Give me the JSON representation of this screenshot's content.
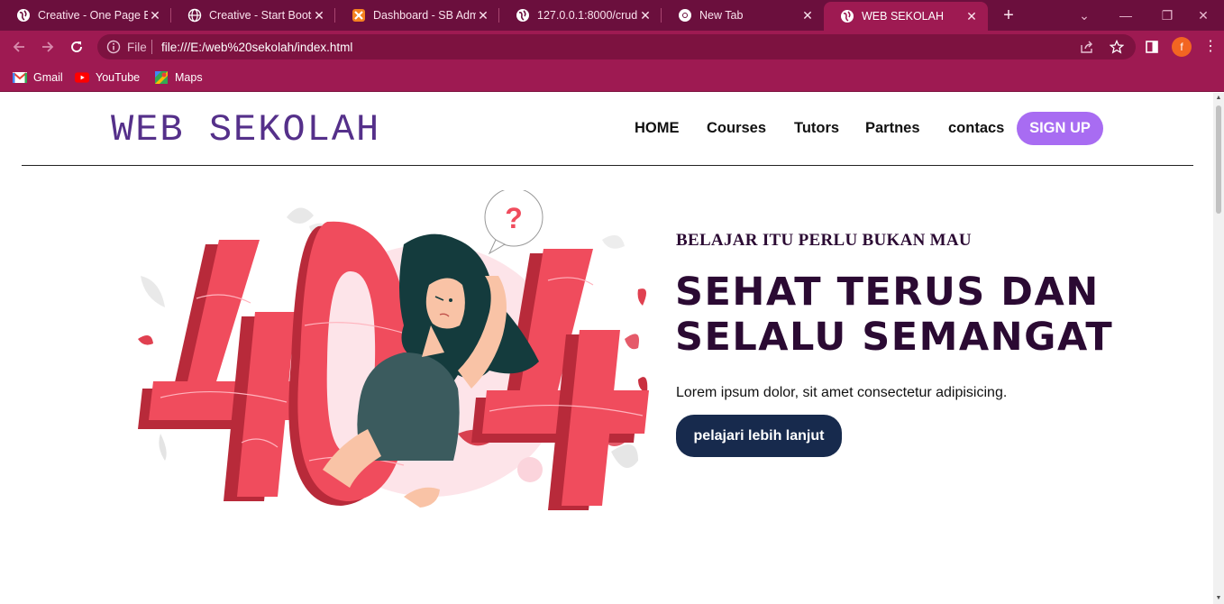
{
  "browser": {
    "tabs": [
      {
        "title": "Creative - One Page Bootstrap",
        "icon": "globe-icon",
        "active": false
      },
      {
        "title": "Creative - Start Bootstrap",
        "icon": "globe-icon",
        "active": false
      },
      {
        "title": "Dashboard - SB Admin",
        "icon": "xampp-icon",
        "active": false
      },
      {
        "title": "127.0.0.1:8000/crud",
        "icon": "globe-icon",
        "active": false
      },
      {
        "title": "New Tab",
        "icon": "chrome-icon",
        "active": false
      },
      {
        "title": "WEB SEKOLAH",
        "icon": "globe-icon",
        "active": true
      }
    ],
    "address": {
      "scheme": "File",
      "url": "file:///E:/web%20sekolah/index.html"
    },
    "profile_initial": "f",
    "bookmarks": [
      {
        "label": "Gmail",
        "icon": "gmail-icon"
      },
      {
        "label": "YouTube",
        "icon": "youtube-icon"
      },
      {
        "label": "Maps",
        "icon": "maps-icon"
      }
    ]
  },
  "page": {
    "logo": "WEB SEKOLAH",
    "nav": {
      "home": "HOME",
      "courses": "Courses",
      "tutors": "Tutors",
      "partners": "Partnes",
      "contacts": "contacs",
      "signup": "SIGN UP"
    },
    "hero": {
      "kicker": "BELAJAR ITU PERLU BUKAN MAU",
      "headline_line1": "SEHAT TERUS DAN",
      "headline_line2": "SELALU SEMANGAT",
      "lead": "Lorem ipsum dolor, sit amet consectetur adipisicing.",
      "cta": "pelajari lebih lanjut",
      "illustration_text": "404"
    }
  },
  "colors": {
    "tabbar": "#6b0f3d",
    "toolbar": "#9e1a52",
    "logo": "#55308a",
    "signup": "#a86cf2",
    "headline": "#2b0a33",
    "cta": "#172a4d",
    "illustration_red": "#f04c5d"
  }
}
